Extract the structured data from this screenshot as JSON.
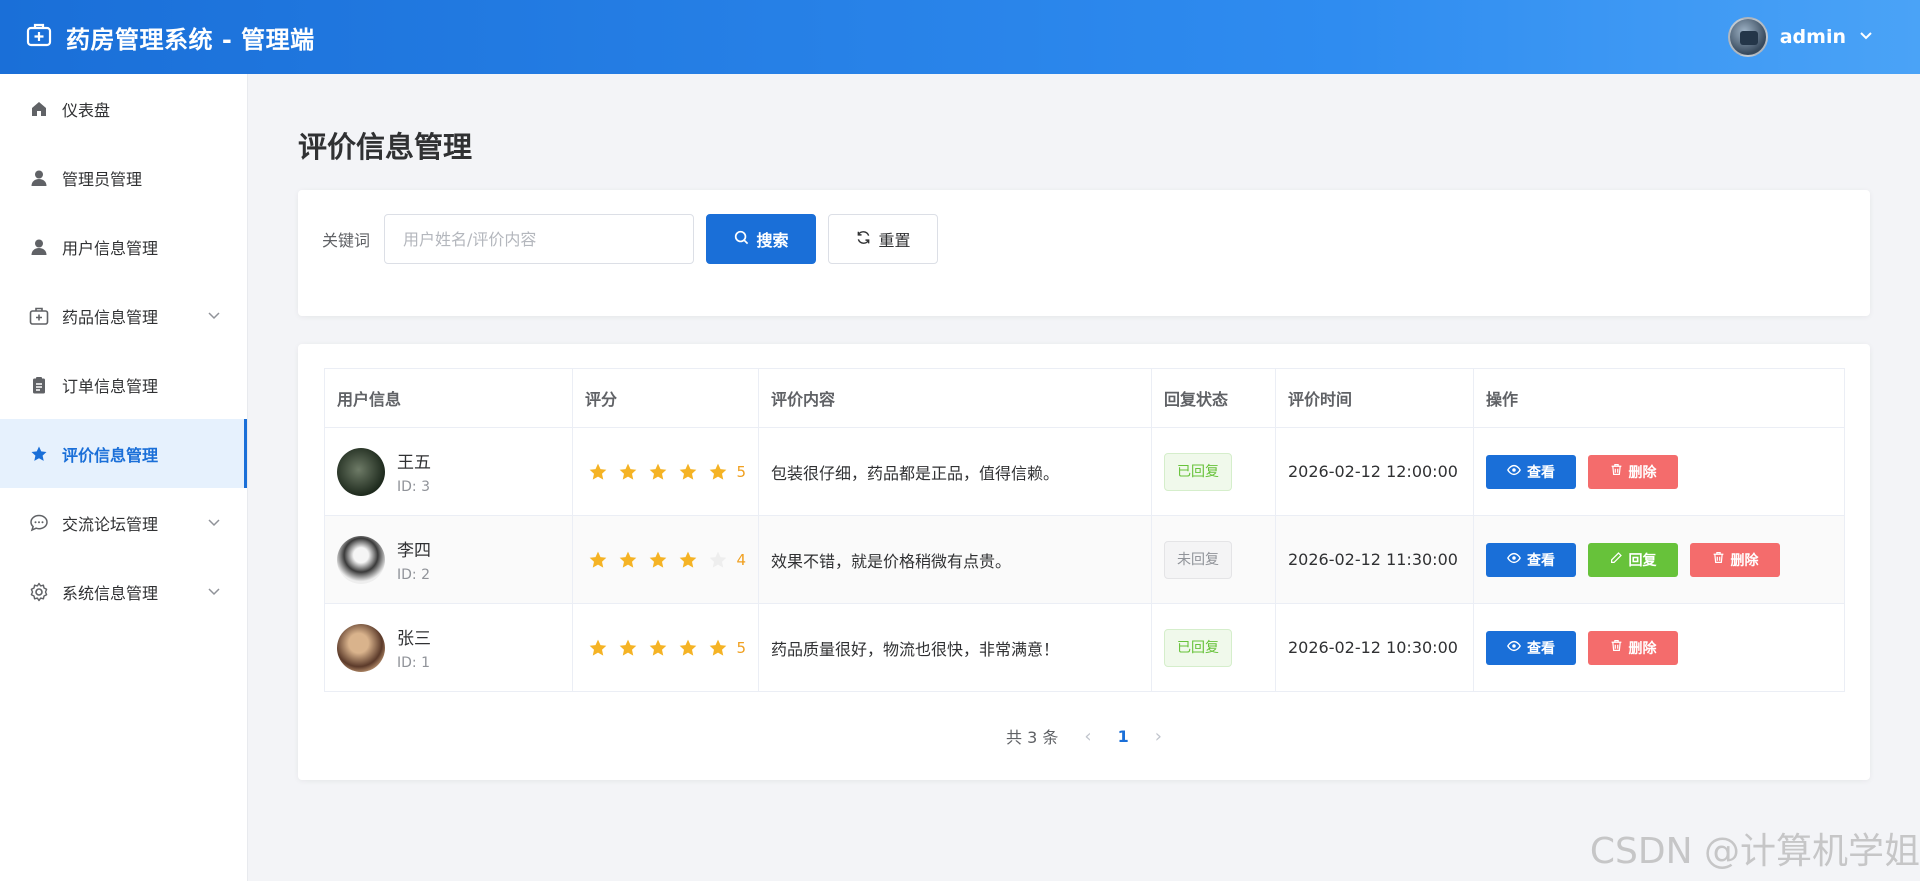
{
  "header": {
    "title": "药房管理系统 - 管理端",
    "username": "admin"
  },
  "sidebar": {
    "items": [
      {
        "label": "仪表盘",
        "icon": "home-icon"
      },
      {
        "label": "管理员管理",
        "icon": "user-icon"
      },
      {
        "label": "用户信息管理",
        "icon": "user-icon"
      },
      {
        "label": "药品信息管理",
        "icon": "medkit-icon",
        "expandable": true
      },
      {
        "label": "订单信息管理",
        "icon": "clipboard-icon"
      },
      {
        "label": "评价信息管理",
        "icon": "star-icon",
        "active": true
      },
      {
        "label": "交流论坛管理",
        "icon": "chat-icon",
        "expandable": true
      },
      {
        "label": "系统信息管理",
        "icon": "gear-icon",
        "expandable": true
      }
    ]
  },
  "page": {
    "title": "评价信息管理"
  },
  "search": {
    "label": "关键词",
    "placeholder": "用户姓名/评价内容",
    "search_label": "搜索",
    "reset_label": "重置"
  },
  "table": {
    "headers": [
      "用户信息",
      "评分",
      "评价内容",
      "回复状态",
      "评价时间",
      "操作"
    ],
    "rows": [
      {
        "name": "王五",
        "id": "ID: 3",
        "rating": 5,
        "score": "5",
        "content": "包装很仔细，药品都是正品，值得信赖。",
        "status": "已回复",
        "time": "2026-02-12 12:00:00"
      },
      {
        "name": "李四",
        "id": "ID: 2",
        "rating": 4,
        "score": "4",
        "content": "效果不错，就是价格稍微有点贵。",
        "status": "未回复",
        "time": "2026-02-12 11:30:00"
      },
      {
        "name": "张三",
        "id": "ID: 1",
        "rating": 5,
        "score": "5",
        "content": "药品质量很好，物流也很快，非常满意！",
        "status": "已回复",
        "time": "2026-02-12 10:30:00"
      }
    ],
    "actions": {
      "view": "查看",
      "reply": "回复",
      "delete": "删除"
    }
  },
  "pagination": {
    "total": "共 3 条",
    "current": "1"
  },
  "watermark": "CSDN @计算机学姐",
  "colors": {
    "primary": "#1a6fd8",
    "success": "#67c23a",
    "danger": "#f46c6c",
    "star": "#f5b324"
  }
}
